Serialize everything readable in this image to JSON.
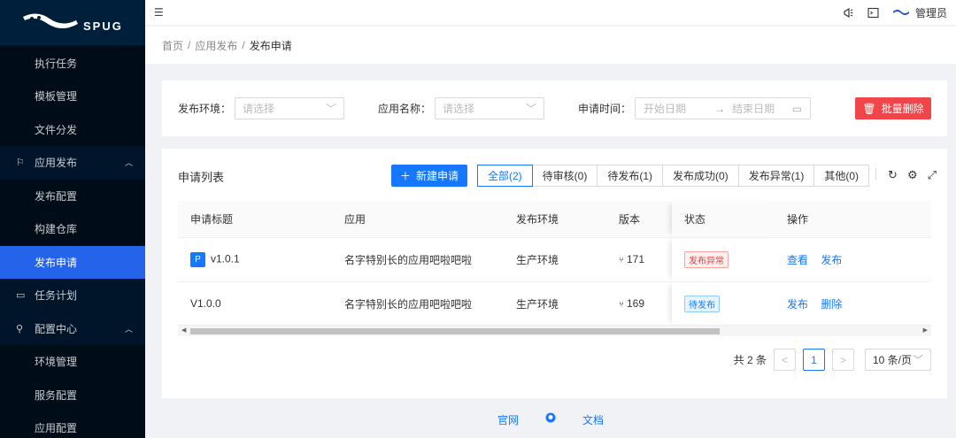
{
  "brand": {
    "name": "SPUG"
  },
  "sidebar": {
    "items": [
      {
        "label": "执行任务",
        "kind": "sub"
      },
      {
        "label": "模板管理",
        "kind": "sub"
      },
      {
        "label": "文件分发",
        "kind": "sub"
      },
      {
        "label": "应用发布",
        "kind": "group",
        "icon": "deploy-icon"
      },
      {
        "label": "发布配置",
        "kind": "sub"
      },
      {
        "label": "构建仓库",
        "kind": "sub"
      },
      {
        "label": "发布申请",
        "kind": "sub",
        "active": true
      },
      {
        "label": "任务计划",
        "kind": "group",
        "icon": "schedule-icon"
      },
      {
        "label": "配置中心",
        "kind": "group",
        "icon": "config-icon"
      },
      {
        "label": "环境管理",
        "kind": "sub"
      },
      {
        "label": "服务配置",
        "kind": "sub"
      },
      {
        "label": "应用配置",
        "kind": "sub"
      }
    ]
  },
  "header": {
    "user": "管理员"
  },
  "breadcrumb": {
    "home": "首页",
    "parent": "应用发布",
    "current": "发布申请"
  },
  "filter": {
    "env_label": "发布环境：",
    "env_placeholder": "请选择",
    "app_label": "应用名称：",
    "app_placeholder": "请选择",
    "time_label": "申请时间：",
    "start_placeholder": "开始日期",
    "end_placeholder": "结束日期",
    "batch_delete": "批量删除"
  },
  "list": {
    "title": "申请列表",
    "new_button": "新建申请",
    "tabs": [
      "全部(2)",
      "待审核(0)",
      "待发布(1)",
      "发布成功(0)",
      "发布异常(1)",
      "其他(0)"
    ],
    "columns": [
      "申请标题",
      "应用",
      "发布环境",
      "版本",
      "状态",
      "操作"
    ],
    "rows": [
      {
        "tag": "P",
        "title": "v1.0.1",
        "app": "名字特别长的应用吧啦吧啦",
        "env": "生产环境",
        "version": "171",
        "status": "发布异常",
        "status_type": "error",
        "actions": [
          "查看",
          "发布"
        ]
      },
      {
        "tag": "",
        "title": "V1.0.0",
        "app": "名字特别长的应用吧啦吧啦",
        "env": "生产环境",
        "version": "169",
        "status": "待发布",
        "status_type": "wait",
        "actions": [
          "发布",
          "删除"
        ]
      }
    ]
  },
  "pagination": {
    "total": "共 2 条",
    "current": "1",
    "page_size": "10 条/页"
  },
  "footer": {
    "site": "官网",
    "docs": "文档"
  },
  "colors": {
    "primary": "#1677ff",
    "danger": "#f0464a",
    "sidebar_bg": "#001529",
    "active_nav": "#2563eb"
  }
}
